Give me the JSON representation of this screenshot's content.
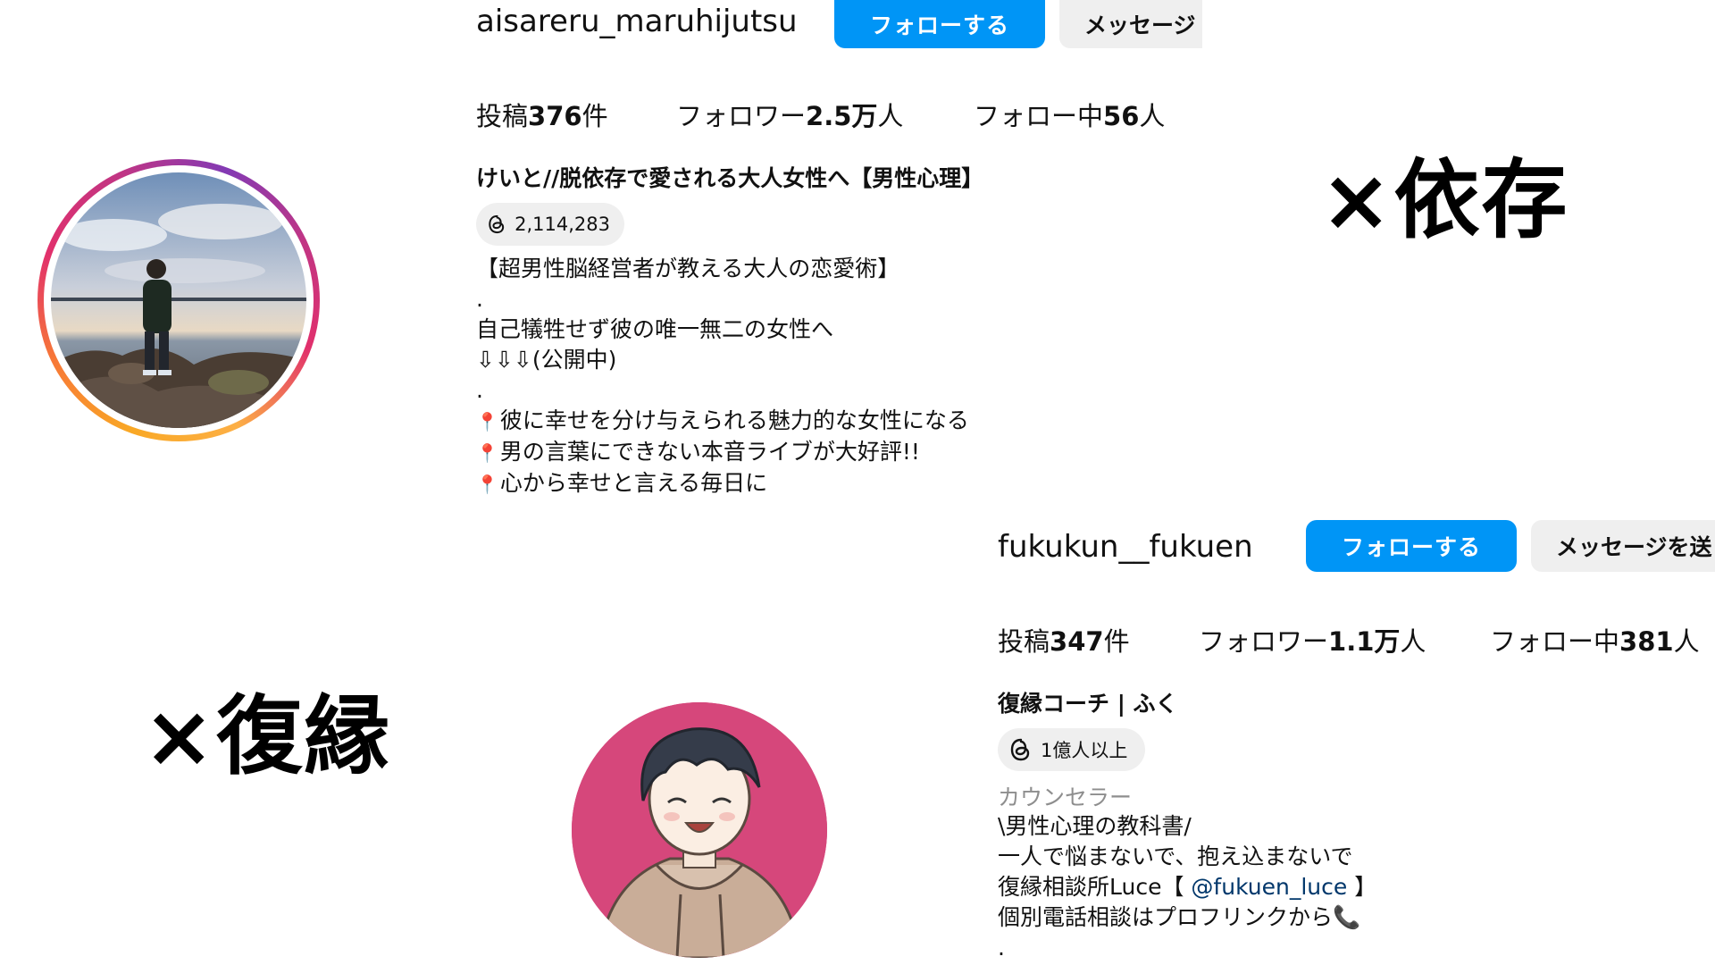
{
  "profile1": {
    "username": "aisareru_maruhijutsu",
    "follow_label": "フォローする",
    "message_label": "メッセージ",
    "stats": {
      "posts_prefix": "投稿",
      "posts_value": "376",
      "posts_suffix": "件",
      "followers_prefix": "フォロワー",
      "followers_value": "2.5万",
      "followers_suffix": "人",
      "following_prefix": "フォロー中",
      "following_value": "56",
      "following_suffix": "人"
    },
    "display_name": "けいと//脱依存で愛される大人女性へ【男性心理】",
    "threads_count": "2,114,283",
    "bio": {
      "line1": "【超男性脳経営者が教える大人の恋愛術】",
      "dot1": ".",
      "line2": "自己犠牲せず彼の唯一無二の女性へ",
      "line3": "⇩⇩⇩(公開中)",
      "dot2": ".",
      "line4": "彼に幸せを分け与えられる魅力的な女性になる",
      "line5": "男の言葉にできない本音ライブが大好評!!",
      "line6": "心から幸せと言える毎日に"
    }
  },
  "profile2": {
    "username": "fukukun__fukuen",
    "follow_label": "フォローする",
    "message_label": "メッセージを送",
    "stats": {
      "posts_prefix": "投稿",
      "posts_value": "347",
      "posts_suffix": "件",
      "followers_prefix": "フォロワー",
      "followers_value": "1.1万",
      "followers_suffix": "人",
      "following_prefix": "フォロー中",
      "following_value": "381",
      "following_suffix": "人"
    },
    "display_name": "復縁コーチ | ふく",
    "threads_count": "1億人以上",
    "category": "カウンセラー",
    "bio": {
      "line1": "\\男性心理の教科書/",
      "line2": "一人で悩まないで、抱え込まないで",
      "line3_prefix": "復縁相談所Luce【 ",
      "line3_mention": "@fukuen_luce",
      "line3_suffix": " 】",
      "line4": "個別電話相談はプロフリンクから📞",
      "dot": "."
    }
  },
  "labels": {
    "izon": "×依存",
    "fukuen": "×復縁"
  },
  "colors": {
    "follow_blue": "#0095f6",
    "button_gray": "#efefef",
    "avatar2_bg": "#d6477b"
  }
}
